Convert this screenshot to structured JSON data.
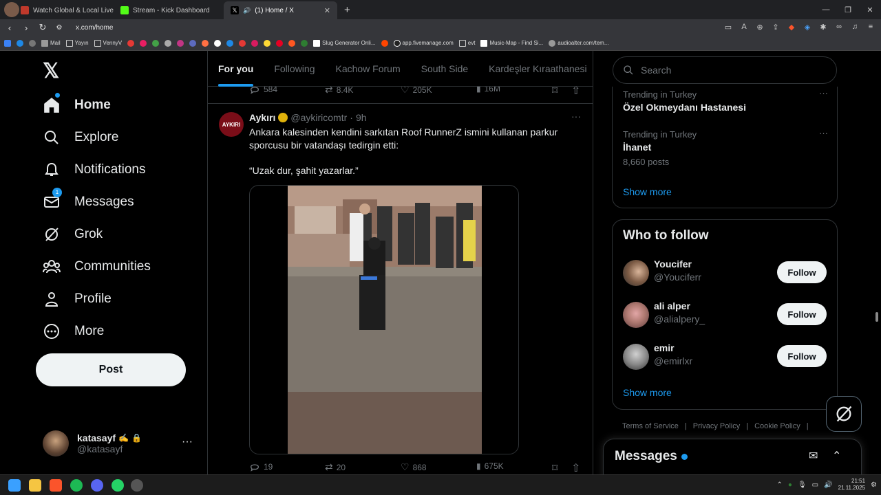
{
  "browser": {
    "tabs": [
      {
        "label": "Watch Global & Local Live TV Onl",
        "active": false
      },
      {
        "label": "Stream - Kick Dashboard",
        "active": false
      },
      {
        "label": "(1) Home / X",
        "active": true
      }
    ],
    "new_tab_label": "+",
    "url": "x.com/home",
    "bookmarks": [
      {
        "label": "Mail"
      },
      {
        "label": "Yayın"
      },
      {
        "label": "VennyV"
      },
      {
        "label": "Slug Generator Onli..."
      },
      {
        "label": "app.fivemanage.com"
      },
      {
        "label": "evt"
      },
      {
        "label": "Music-Map - Find Si..."
      },
      {
        "label": "audioalter.com/tem..."
      }
    ]
  },
  "nav": {
    "items": [
      {
        "label": "Home",
        "icon": "home-icon"
      },
      {
        "label": "Explore",
        "icon": "search-icon"
      },
      {
        "label": "Notifications",
        "icon": "bell-icon"
      },
      {
        "label": "Messages",
        "icon": "mail-icon",
        "badge": "1"
      },
      {
        "label": "Grok",
        "icon": "grok-icon"
      },
      {
        "label": "Communities",
        "icon": "communities-icon"
      },
      {
        "label": "Profile",
        "icon": "person-icon"
      },
      {
        "label": "More",
        "icon": "more-circle-icon"
      }
    ],
    "post_label": "Post",
    "account": {
      "name": "katasayf",
      "handle": "@katasayf",
      "more": "···"
    }
  },
  "feed": {
    "tabs": [
      {
        "label": "For you",
        "active": true
      },
      {
        "label": "Following",
        "active": false
      },
      {
        "label": "Kachow Forum",
        "active": false
      },
      {
        "label": "South Side",
        "active": false
      },
      {
        "label": "Kardeşler Kıraathanesi",
        "active": false
      }
    ],
    "prev_tweet_stats": {
      "replies": "584",
      "reposts": "8.4K",
      "likes": "205K",
      "views": "16M"
    },
    "tweet": {
      "avatar_text": "AYKIRI",
      "name": "Aykırı",
      "handle": "@aykiricomtr",
      "time": "9h",
      "dot": "·",
      "more": "···",
      "text_line1": "Ankara kalesinden kendini sarkıtan Roof RunnerZ ismini kullanan parkur sporcusu bir vatandaşı tedirgin etti:",
      "text_line2": "“Uzak dur, şahit yazarlar.”",
      "stats": {
        "replies": "19",
        "reposts": "20",
        "likes": "868",
        "views": "675K"
      }
    }
  },
  "sidebar": {
    "search_placeholder": "Search",
    "trends": [
      {
        "context": "Trending in Turkey",
        "name": "Özel Okmeydanı Hastanesi",
        "posts": ""
      },
      {
        "context": "Trending in Turkey",
        "name": "İhanet",
        "posts": "8,660 posts"
      }
    ],
    "trend_more": "···",
    "trends_show_more": "Show more",
    "who_to_follow": {
      "title": "Who to follow",
      "users": [
        {
          "name": "Youcifer",
          "handle": "@Youciferr",
          "button": "Follow"
        },
        {
          "name": "ali alper",
          "handle": "@alialpery_",
          "button": "Follow"
        },
        {
          "name": "emir",
          "handle": "@emirlxr",
          "button": "Follow"
        }
      ],
      "show_more": "Show more"
    },
    "footer": [
      "Terms of Service",
      "|",
      "Privacy Policy",
      "|",
      "Cookie Policy",
      "|"
    ],
    "messages_title": "Messages"
  },
  "taskbar": {
    "time": "21:51",
    "date": "21.11.2025"
  }
}
